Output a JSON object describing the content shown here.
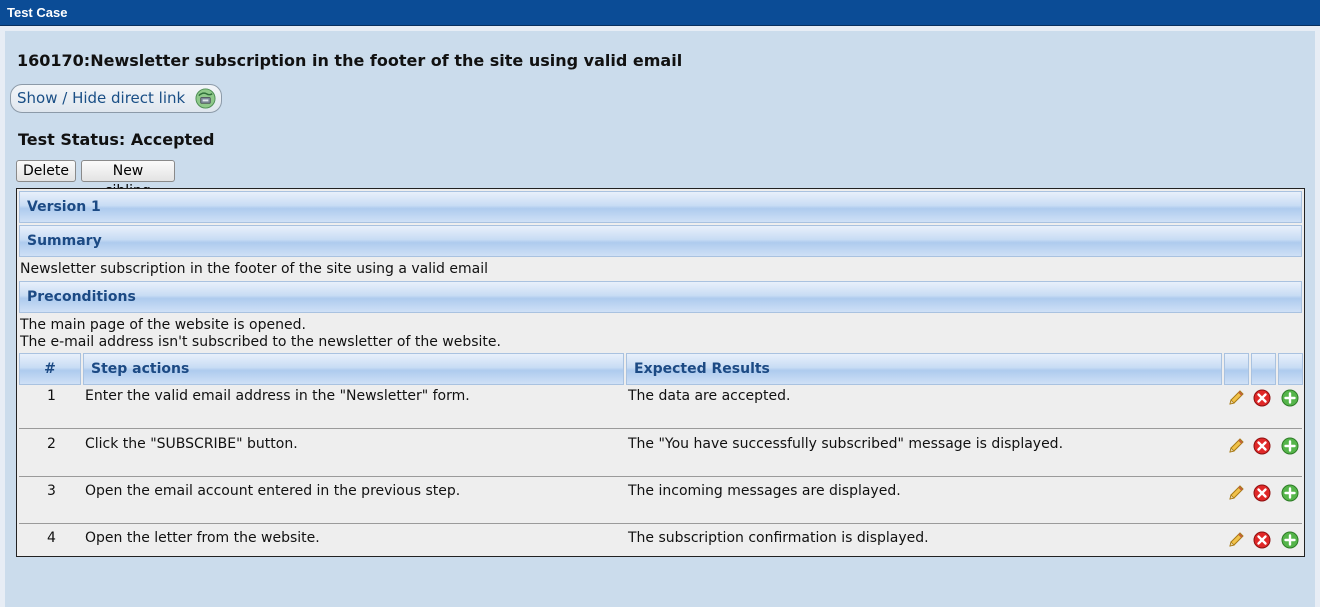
{
  "window": {
    "title": "Test Case"
  },
  "testcase": {
    "title": "160170:Newsletter subscription in the footer of the site using valid email",
    "direct_link_label": "Show / Hide direct link",
    "status": "Test Status: Accepted",
    "delete_label": "Delete",
    "new_sibling_label": "New sibling"
  },
  "version": {
    "label": "Version 1"
  },
  "summary": {
    "header": "Summary",
    "text": "Newsletter subscription in the footer of the site using a valid email"
  },
  "preconditions": {
    "header": "Preconditions",
    "lines": [
      "The main page of the website is opened.",
      "The e-mail address isn't subscribed to the newsletter of the website."
    ]
  },
  "steps_table": {
    "headers": [
      "#",
      "Step actions",
      "Expected Results"
    ],
    "rows": [
      {
        "num": "1",
        "action": "Enter the valid email address in the \"Newsletter\" form.",
        "expected": "The data are accepted."
      },
      {
        "num": "2",
        "action": "Click the \"SUBSCRIBE\" button.",
        "expected": "The \"You have successfully subscribed\" message is displayed."
      },
      {
        "num": "3",
        "action": "Open the email account entered in the previous step.",
        "expected": "The incoming messages are displayed."
      },
      {
        "num": "4",
        "action": "Open the letter from the website.",
        "expected": "The subscription confirmation is displayed."
      }
    ],
    "row_icons": [
      "edit-pencil-icon",
      "delete-x-icon",
      "add-plus-icon"
    ]
  },
  "colors": {
    "titlebar": "#0b4c96",
    "panel": "#cbdcec",
    "section_text": "#1c4a84"
  }
}
